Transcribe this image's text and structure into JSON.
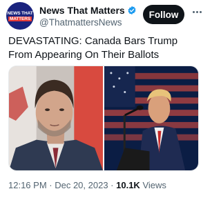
{
  "account": {
    "avatar_text_line1": "NEWS THAT",
    "avatar_text_line2": "MATTERS",
    "display_name": "News That Matters",
    "handle": "@ThatmattersNews",
    "verified": true
  },
  "actions": {
    "follow_label": "Follow",
    "more_icon": "more-horizontal-icon"
  },
  "tweet": {
    "text": "DEVASTATING: Canada Bars Trump From Appearing On Their Ballots"
  },
  "media": {
    "images": [
      "photo-man-in-front-of-canadian-flag",
      "photo-man-at-podium-in-front-of-us-flag"
    ]
  },
  "meta": {
    "time": "12:16 PM",
    "separator1": " · ",
    "date": "Dec 20, 2023",
    "separator2": " · ",
    "views_count": "10.1K",
    "views_label": " Views"
  },
  "colors": {
    "follow_bg": "#0f1419",
    "verified": "#1d9bf0",
    "secondary_text": "#536471"
  }
}
